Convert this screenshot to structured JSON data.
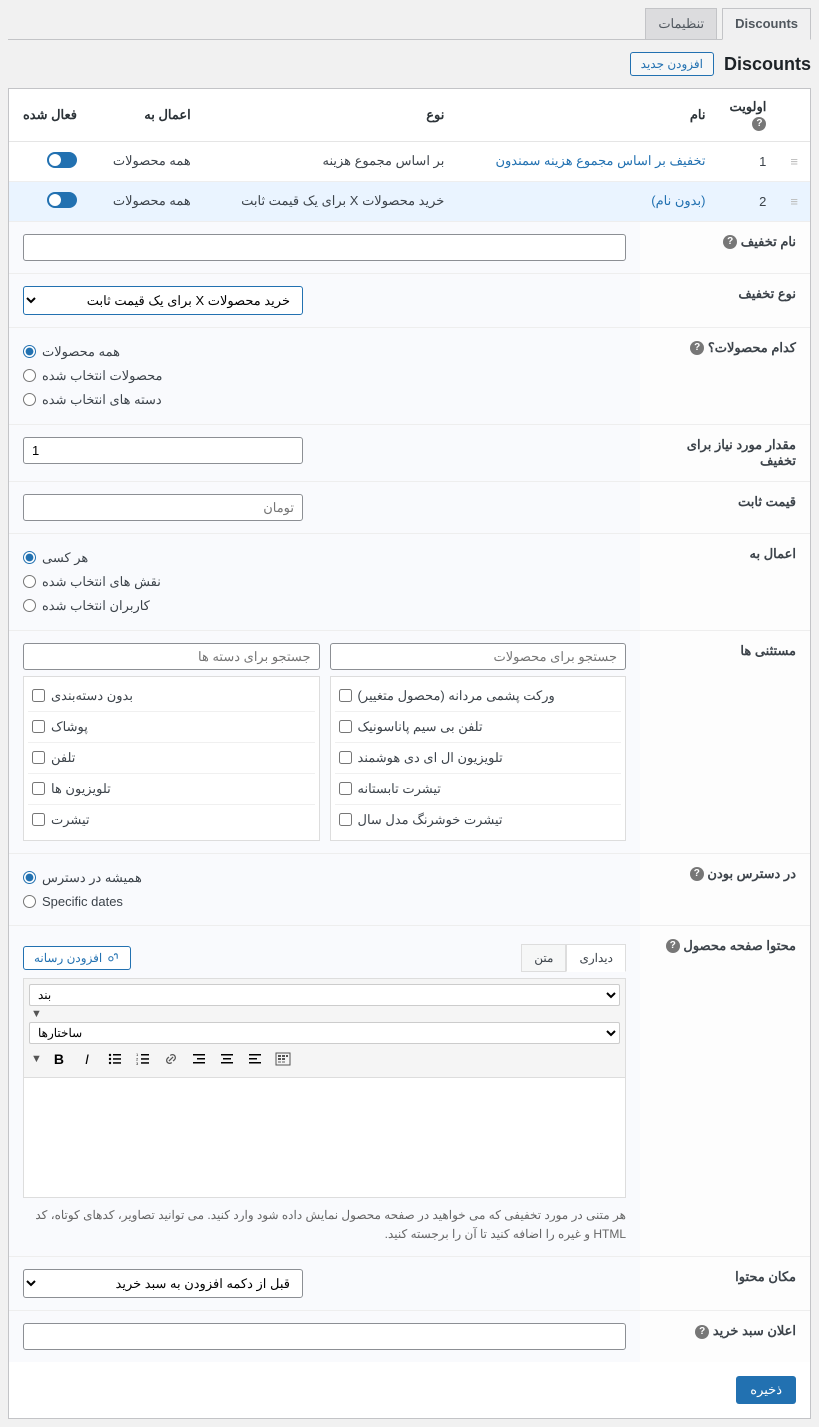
{
  "tabs": {
    "discounts": "Discounts",
    "settings": "تنظیمات"
  },
  "pageTitle": "Discounts",
  "addNew": "افزودن جدید",
  "cols": {
    "priority": "اولویت",
    "name": "نام",
    "type": "نوع",
    "applyTo": "اعمال به",
    "enabled": "فعال شده"
  },
  "rows": [
    {
      "priority": "1",
      "name": "تخفیف بر اساس مجموع هزینه سمندون",
      "type": "بر اساس مجموع هزینه",
      "applyTo": "همه محصولات"
    },
    {
      "priority": "2",
      "name": "(بدون نام)",
      "type": "خرید محصولات X برای یک قیمت ثابت",
      "applyTo": "همه محصولات"
    }
  ],
  "labels": {
    "discountName": "نام تخفیف",
    "discountType": "نوع تخفیف",
    "whichProducts": "کدام محصولات؟",
    "reqAmount": "مقدار مورد نیاز برای تخفیف",
    "fixedPrice": "قیمت ثابت",
    "applyTo": "اعمال به",
    "exclusions": "مستثنی ها",
    "availability": "در دسترس بودن",
    "productContent": "محتوا صفحه محصول",
    "contentLoc": "مکان محتوا",
    "cartNotice": "اعلان سبد خرید"
  },
  "typeSelect": "خرید محصولات X برای یک قیمت ثابت",
  "prodOpts": {
    "all": "همه محصولات",
    "sel": "محصولات انتخاب شده",
    "cat": "دسته های انتخاب شده"
  },
  "reqVal": "1",
  "fixedPh": "تومان",
  "applyOpts": {
    "all": "هر کسی",
    "roles": "نقش های انتخاب شده",
    "users": "کاربران انتخاب شده"
  },
  "search": {
    "prod": "جستجو برای محصولات",
    "cat": "جستجو برای دسته ها"
  },
  "prodList": [
    "ورکت پشمی مردانه (محصول متغییر)",
    "تلفن بی سیم پاناسونیک",
    "تلویزیون ال ای دی هوشمند",
    "تیشرت تابستانه",
    "تیشرت خوشرنگ مدل سال"
  ],
  "catList": [
    "بدون دسته‌بندی",
    "پوشاک",
    "تلفن",
    "تلویزیون ها",
    "تیشرت"
  ],
  "availOpts": {
    "always": "همیشه در دسترس",
    "dates": "Specific dates"
  },
  "editor": {
    "addMedia": "افزودن رسانه",
    "visual": "دیداری",
    "text": "متن",
    "para": "بند",
    "structs": "ساختارها",
    "desc": "هر متنی در مورد تخفیفی که می خواهید در صفحه محصول نمایش داده شود وارد کنید. می توانید تصاویر، کدهای کوتاه، کد HTML و غیره را اضافه کنید تا آن را برجسته کنید."
  },
  "locSelect": "قبل از دکمه افزودن به سبد خرید",
  "save": "ذخیره"
}
